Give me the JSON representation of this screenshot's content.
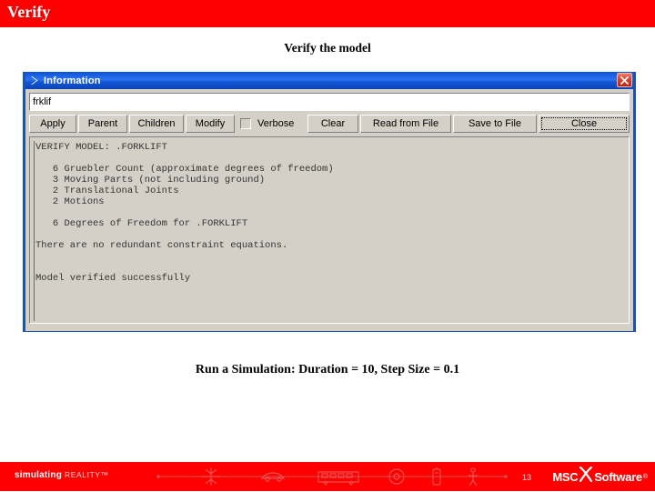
{
  "slide": {
    "header_title": "Verify",
    "subtitle": "Verify the model",
    "caption": "Run a Simulation: Duration = 10, Step Size = 0.1",
    "header_color": "#fe0000"
  },
  "dialog": {
    "title": "Information",
    "icon": "arrow-icon",
    "close_label": "✕",
    "name_field": {
      "value": "frklif",
      "placeholder": ""
    },
    "buttons": {
      "apply": "Apply",
      "parent": "Parent",
      "children": "Children",
      "modify": "Modify",
      "clear": "Clear",
      "read_from_file": "Read from File",
      "save_to_file": "Save to File",
      "close": "Close"
    },
    "verbose": {
      "label": "Verbose",
      "checked": false
    },
    "output": "VERIFY MODEL: .FORKLIFT\n\n   6 Gruebler Count (approximate degrees of freedom)\n   3 Moving Parts (not including ground)\n   2 Translational Joints\n   2 Motions\n\n   6 Degrees of Freedom for .FORKLIFT\n\nThere are no redundant constraint equations.\n\n\nModel verified successfully"
  },
  "footer": {
    "slogan_bold": "simulating",
    "slogan_light": "REALITY™",
    "page_number": "13",
    "logo_msc": "MSC",
    "logo_software": "Software",
    "logo_tm": "®"
  }
}
